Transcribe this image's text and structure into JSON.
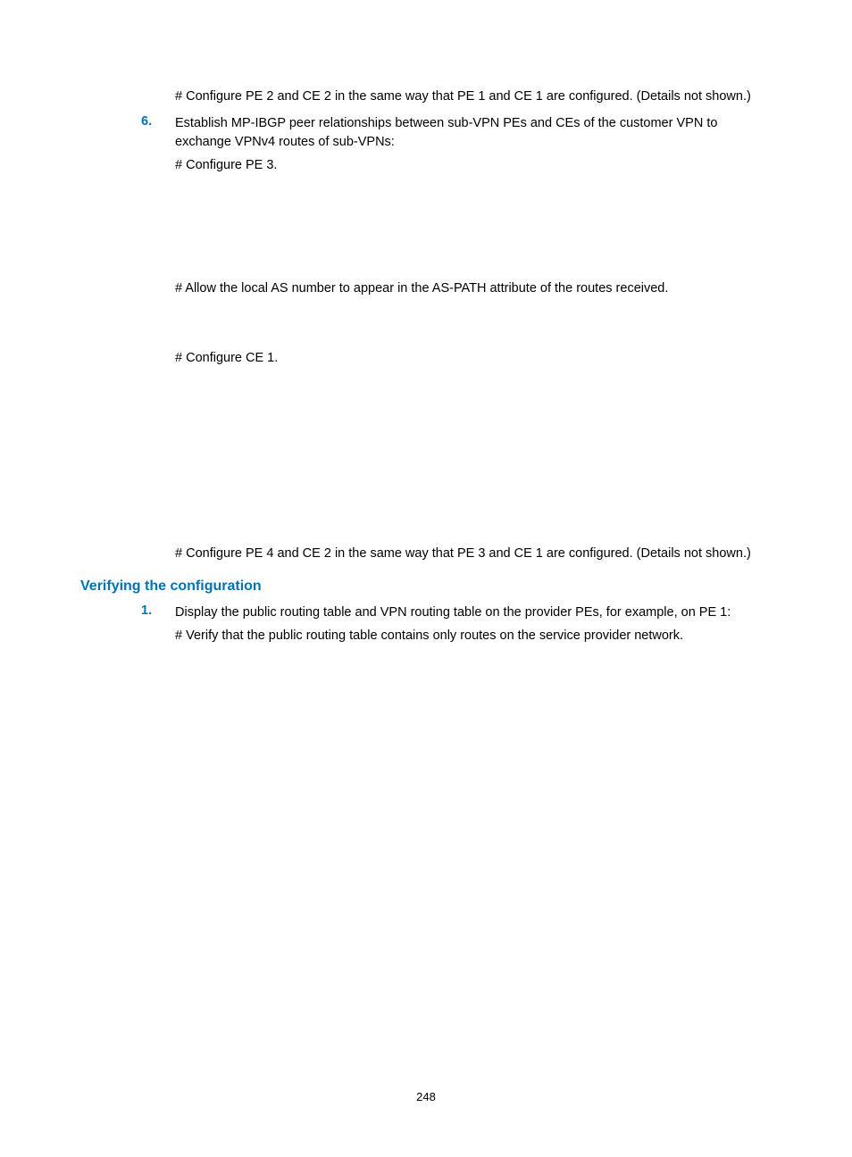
{
  "block1": "# Configure PE 2 and CE 2 in the same way that PE 1 and CE 1 are configured. (Details not shown.)",
  "step6": {
    "num": "6.",
    "intro": "Establish MP-IBGP peer relationships between sub-VPN PEs and CEs of the customer VPN to exchange VPNv4 routes of sub-VPNs:",
    "line1": "# Configure PE 3.",
    "line2": "# Allow the local AS number to appear in the AS-PATH attribute of the routes received.",
    "line3": "# Configure CE 1.",
    "line4": "# Configure PE 4 and CE 2 in the same way that PE 3 and CE 1 are configured. (Details not shown.)"
  },
  "section_heading": "Verifying the configuration",
  "verify1": {
    "num": "1.",
    "intro": "Display the public routing table and VPN routing table on the provider PEs, for example, on PE 1:",
    "line1": "# Verify that the public routing table contains only routes on the service provider network."
  },
  "page_number": "248"
}
